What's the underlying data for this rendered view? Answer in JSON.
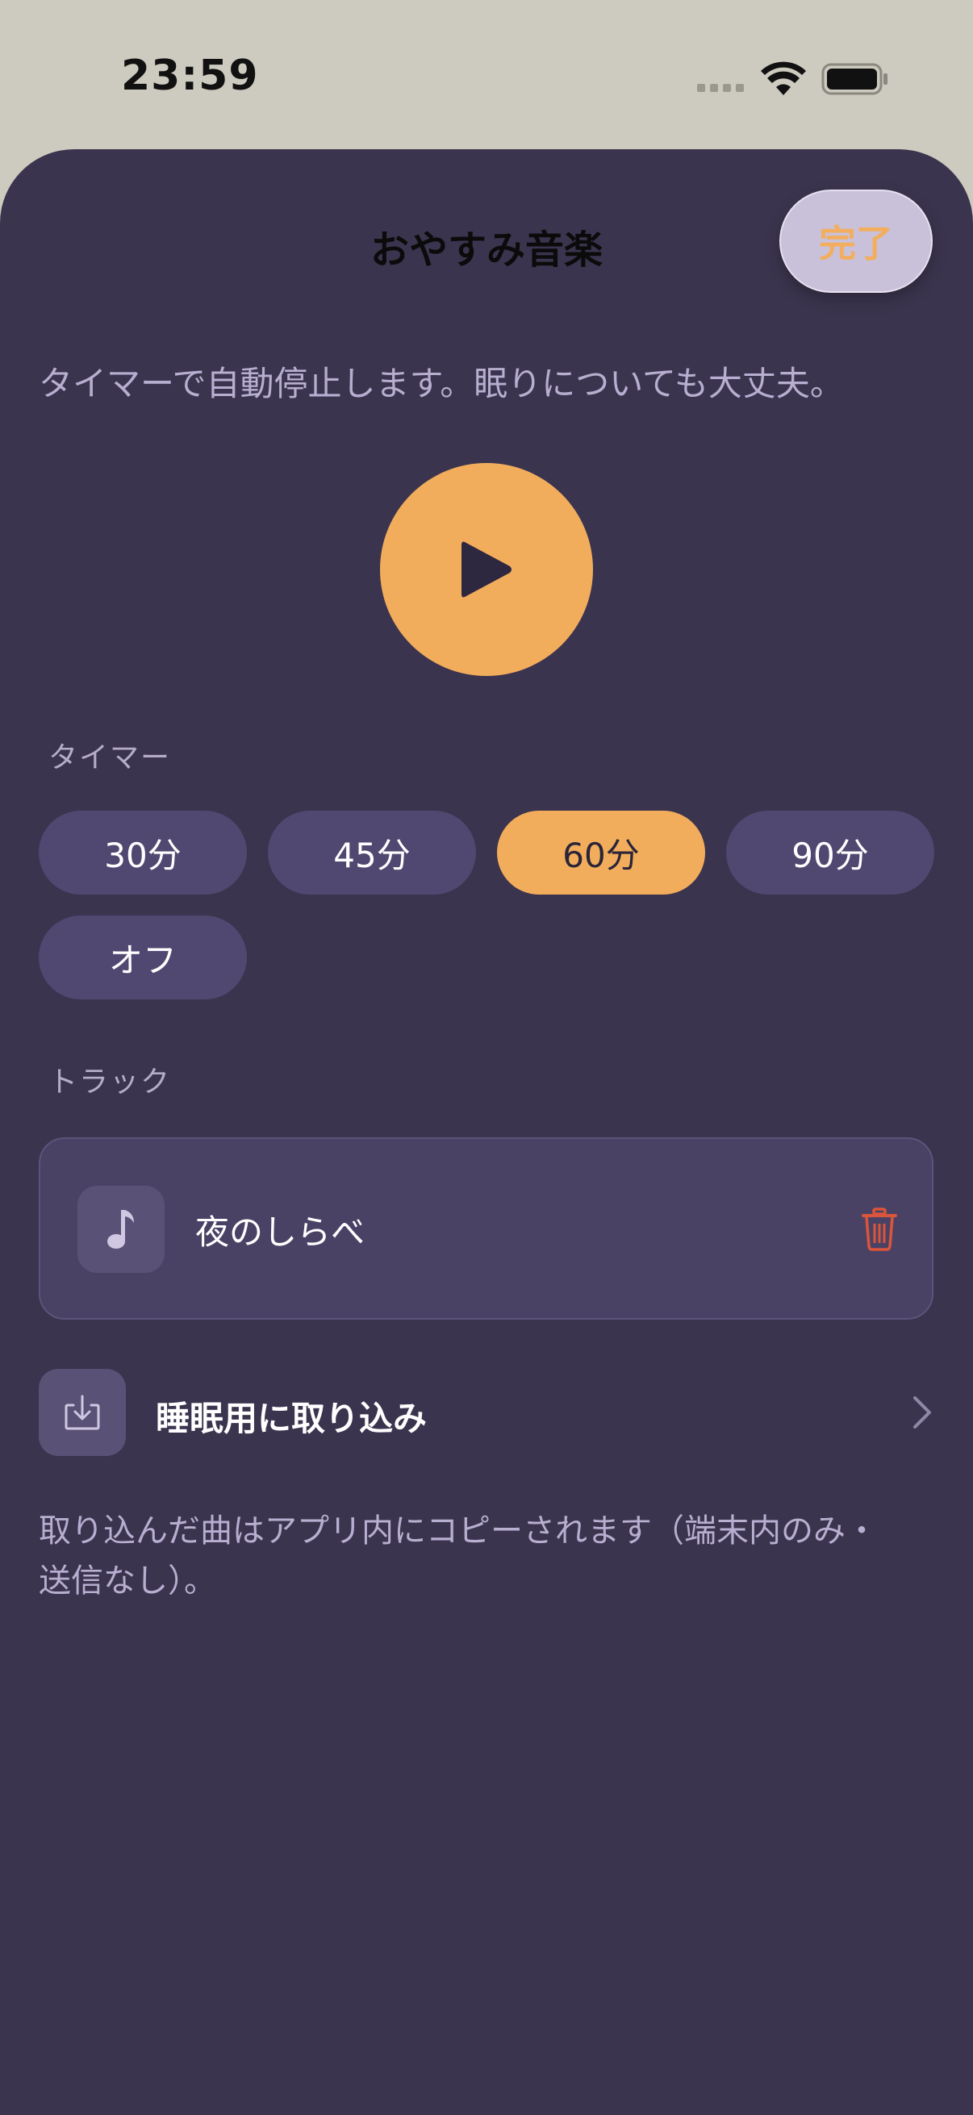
{
  "status_bar": {
    "time": "23:59"
  },
  "header": {
    "title": "おやすみ音楽",
    "done_label": "完了"
  },
  "description": "タイマーで自動停止します。眠りについても大丈夫。",
  "player": {
    "play_icon": "play-icon"
  },
  "timer": {
    "label": "タイマー",
    "options": [
      "30分",
      "45分",
      "60分",
      "90分",
      "オフ"
    ],
    "selected": "60分"
  },
  "tracks": {
    "label": "トラック",
    "items": [
      {
        "name": "夜のしらべ",
        "icon": "music-note-icon"
      }
    ]
  },
  "import": {
    "label": "睡眠用に取り込み",
    "icon": "download-tray-icon"
  },
  "note": "取り込んだ曲はアプリ内にコピーされます（端末内のみ・送信なし）。",
  "colors": {
    "background": "#3b344e",
    "accent": "#f2ad5c",
    "chip": "#514871",
    "card": "#4a4265",
    "muted_text": "#b7aed0",
    "delete": "#d9553b"
  }
}
